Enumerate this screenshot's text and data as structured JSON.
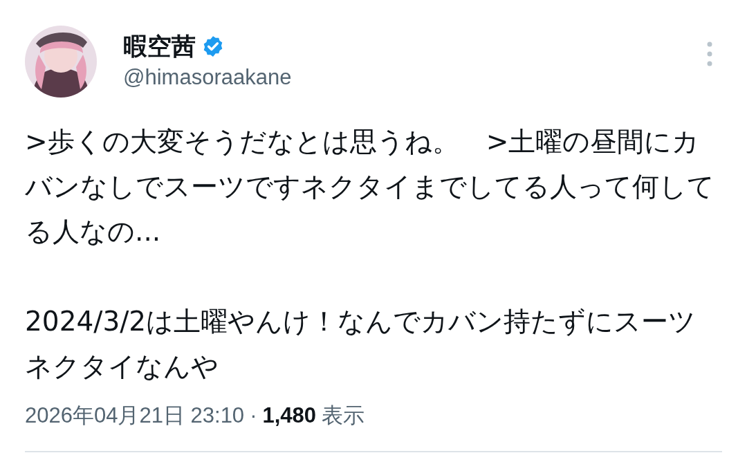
{
  "author": {
    "name": "暇空茜",
    "verified": true,
    "handle": "@himasoraakane"
  },
  "body": {
    "paragraphs": [
      ">歩くの大変そうだなとは思うね。　>土曜の昼間にカバンなしでスーツですネクタイまでしてる人って何してる人なの...",
      "2024/3/2は土曜やんけ！なんでカバン持たずにスーツネクタイなんや"
    ]
  },
  "meta": {
    "timestamp": "2026年04月21日 23:10",
    "separator": "·",
    "views": "1,480",
    "views_label": "表示"
  }
}
